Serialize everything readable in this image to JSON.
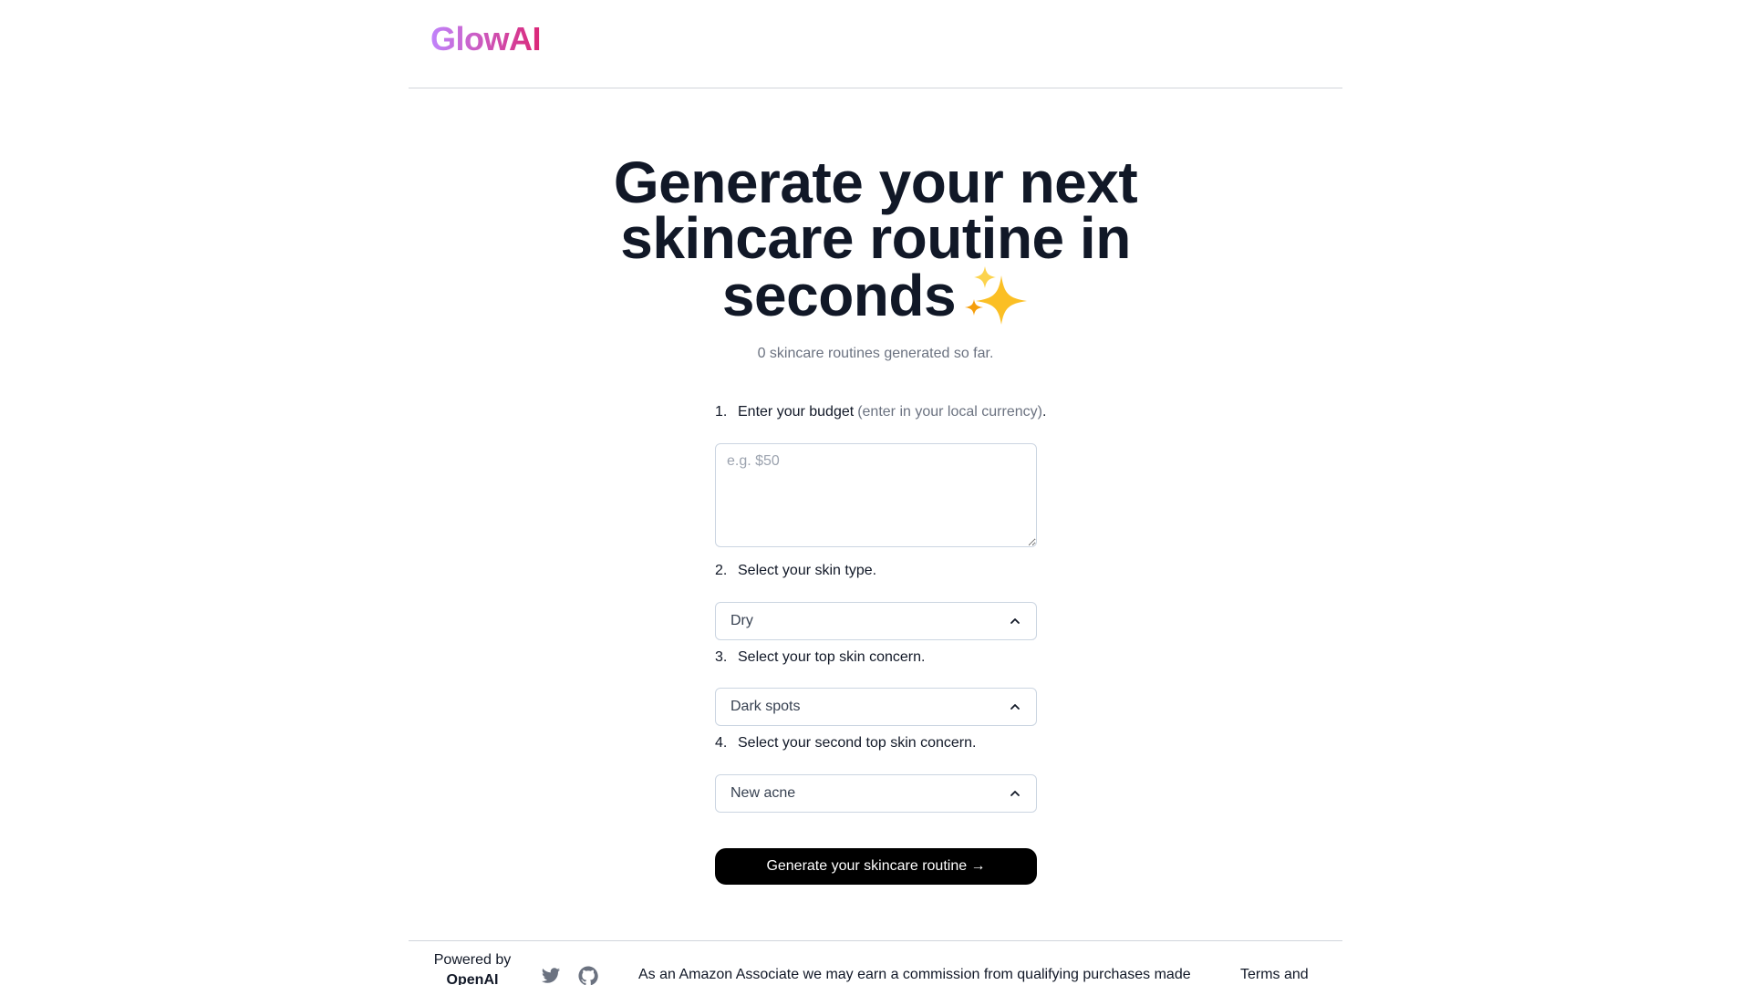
{
  "header": {
    "logo": "GlowAI"
  },
  "hero": {
    "title_line1": "Generate your next",
    "title_line2": "skincare routine in",
    "title_line3": "seconds",
    "title_emoji": "sparkles-icon",
    "counter_text": "0 skincare routines generated so far."
  },
  "form": {
    "step1": {
      "number": "1.",
      "label": "Enter your budget",
      "hint": "(enter in your local currency)",
      "suffix": ".",
      "placeholder": "e.g. $50",
      "value": ""
    },
    "step2": {
      "number": "2.",
      "label": "Select your skin type.",
      "selected": "Dry"
    },
    "step3": {
      "number": "3.",
      "label": "Select your top skin concern.",
      "selected": "Dark spots"
    },
    "step4": {
      "number": "4.",
      "label": "Select your second top skin concern.",
      "selected": "New acne"
    },
    "submit_label": "Generate your skincare routine →"
  },
  "footer": {
    "powered_by": "Powered by",
    "powered_brand": "OpenAI",
    "icons": [
      "twitter-icon",
      "github-icon"
    ],
    "disclaimer": "As an Amazon Associate we may earn a commission from qualifying purchases made",
    "terms": "Terms and"
  },
  "colors": {
    "logo_gradient_start": "#c084fc",
    "logo_gradient_end": "#db2777",
    "button_bg": "#000000",
    "muted_text": "#6b7280"
  }
}
